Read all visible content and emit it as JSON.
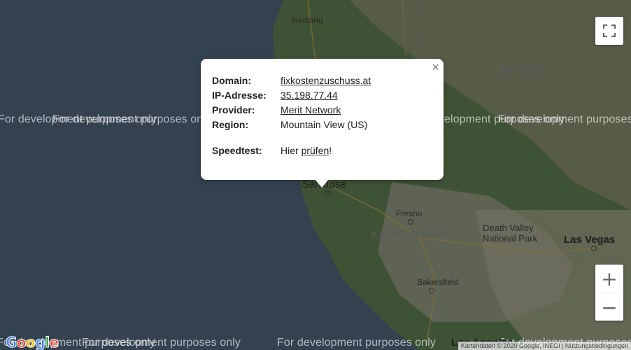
{
  "map": {
    "watermark_text": "For development purposes only",
    "places": {
      "redding": "Redding",
      "nevada": "NEVADA",
      "san_jose": "San Jose",
      "fresno": "Fresno",
      "kalifornien": "KALIFORNIEN",
      "death_valley": "Death Valley\nNational Park",
      "las_vegas": "Las Vegas",
      "bakersfield": "Bakersfield",
      "los_angeles": "Los Angeles"
    },
    "attribution": "Kartendaten © 2020 Google, INEGI | Nutzungsbedingungen",
    "google_logo": "Google",
    "colors": {
      "water": "#4d6277",
      "land": "#5c7a4f",
      "road": "#c9a44a"
    }
  },
  "controls": {
    "fullscreen_icon": "fullscreen-icon",
    "zoom_in": "+",
    "zoom_out": "−"
  },
  "popup": {
    "close": "×",
    "rows": [
      {
        "label": "Domain:",
        "value": "fixkostenzuschuss.at"
      },
      {
        "label": "IP-Adresse:",
        "value": "35.198.77.44"
      },
      {
        "label": "Provider:",
        "value": "Merit Network"
      },
      {
        "label": "Region:",
        "value": "Mountain View (US)"
      }
    ],
    "speedtest": {
      "label": "Speedtest:",
      "prefix": "Hier ",
      "link": "prüfen",
      "suffix": "!"
    }
  }
}
